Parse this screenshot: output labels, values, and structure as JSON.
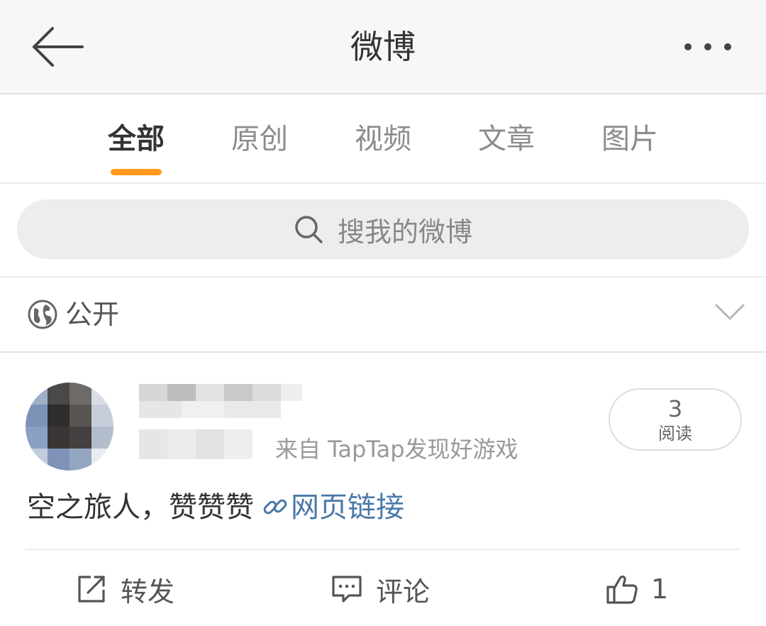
{
  "header": {
    "title": "微博",
    "back_icon": "arrow-left-icon",
    "more_icon": "more-horizontal-icon"
  },
  "tabs": [
    {
      "label": "全部",
      "active": true
    },
    {
      "label": "原创",
      "active": false
    },
    {
      "label": "视频",
      "active": false
    },
    {
      "label": "文章",
      "active": false
    },
    {
      "label": "图片",
      "active": false
    }
  ],
  "search": {
    "placeholder": "搜我的微博",
    "icon": "search-icon"
  },
  "visibility": {
    "label": "公开",
    "icon": "globe-icon",
    "dropdown_icon": "chevron-down-icon"
  },
  "post": {
    "source": "来自 TapTap发现好游戏",
    "read_count": "3",
    "read_label": "阅读",
    "text": "空之旅人，赞赞赞",
    "link_label": "网页链接",
    "link_icon": "link-icon",
    "actions": {
      "repost_label": "转发",
      "comment_label": "评论",
      "like_count": "1"
    }
  },
  "colors": {
    "accent": "#ff9a1a",
    "link": "#4a78a8",
    "header_bg": "#f7f7f7",
    "search_bg": "#ededed"
  }
}
